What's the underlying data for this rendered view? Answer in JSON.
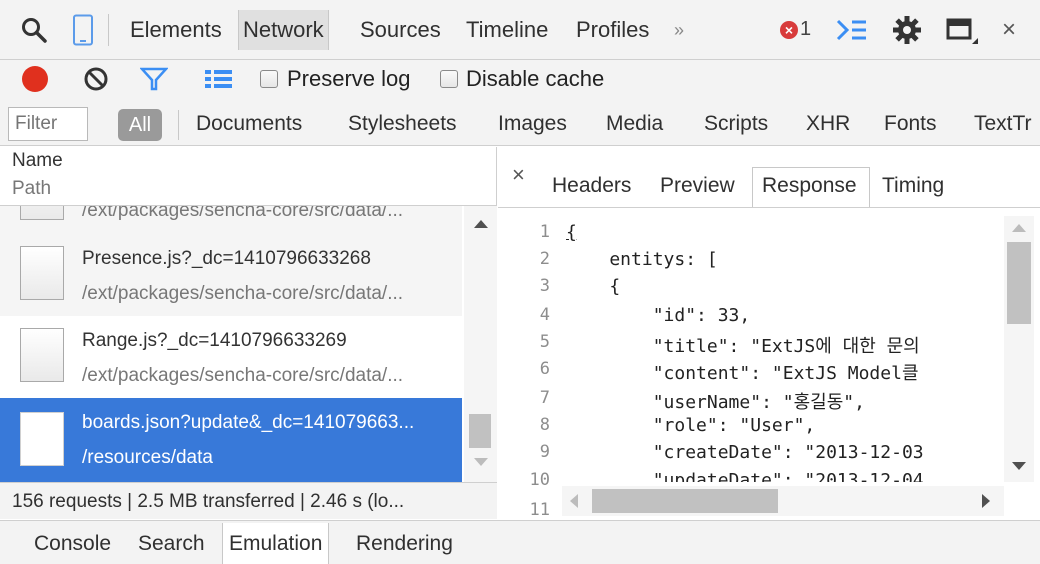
{
  "toolbar": {
    "tabs": [
      "Elements",
      "Network",
      "Sources",
      "Timeline",
      "Profiles"
    ],
    "overflow": "»",
    "error_count": "1",
    "close": "×"
  },
  "controls": {
    "preserve_log": "Preserve log",
    "disable_cache": "Disable cache"
  },
  "filter": {
    "placeholder": "Filter",
    "all": "All",
    "types": [
      "Documents",
      "Stylesheets",
      "Images",
      "Media",
      "Scripts",
      "XHR",
      "Fonts",
      "TextTr"
    ]
  },
  "list": {
    "header_name": "Name",
    "header_path": "Path",
    "rows": [
      {
        "name": "",
        "path": "/ext/packages/sencha-core/src/data/..."
      },
      {
        "name": "Presence.js?_dc=1410796633268",
        "path": "/ext/packages/sencha-core/src/data/..."
      },
      {
        "name": "Range.js?_dc=1410796633269",
        "path": "/ext/packages/sencha-core/src/data/..."
      },
      {
        "name": "boards.json?update&_dc=141079663...",
        "path": "/resources/data"
      }
    ],
    "status": "156 requests | 2.5 MB transferred | 2.46 s (lo..."
  },
  "detail": {
    "close": "×",
    "tabs": [
      "Headers",
      "Preview",
      "Response",
      "Timing"
    ],
    "selected_tab": "Response",
    "line_numbers": [
      "1",
      "2",
      "3",
      "4",
      "5",
      "6",
      "7",
      "8",
      "9",
      "10",
      "11"
    ],
    "code_lines": [
      "{",
      "    entitys: [",
      "    {",
      "        \"id\": 33,",
      "        \"title\": \"ExtJS에 대한 문의",
      "        \"content\": \"ExtJS Model클",
      "        \"userName\": \"홍길동\",",
      "        \"role\": \"User\",",
      "        \"createDate\": \"2013-12-03",
      "        \"updateDate\": \"2013-12-04",
      ""
    ]
  },
  "drawer": {
    "tabs": [
      "Console",
      "Search",
      "Emulation",
      "Rendering"
    ],
    "selected_tab": "Emulation"
  },
  "colors": {
    "record": "#e0301e",
    "selected_row": "#3879d9",
    "filter_icon": "#3b8ef3",
    "error": "#d83b3b"
  }
}
